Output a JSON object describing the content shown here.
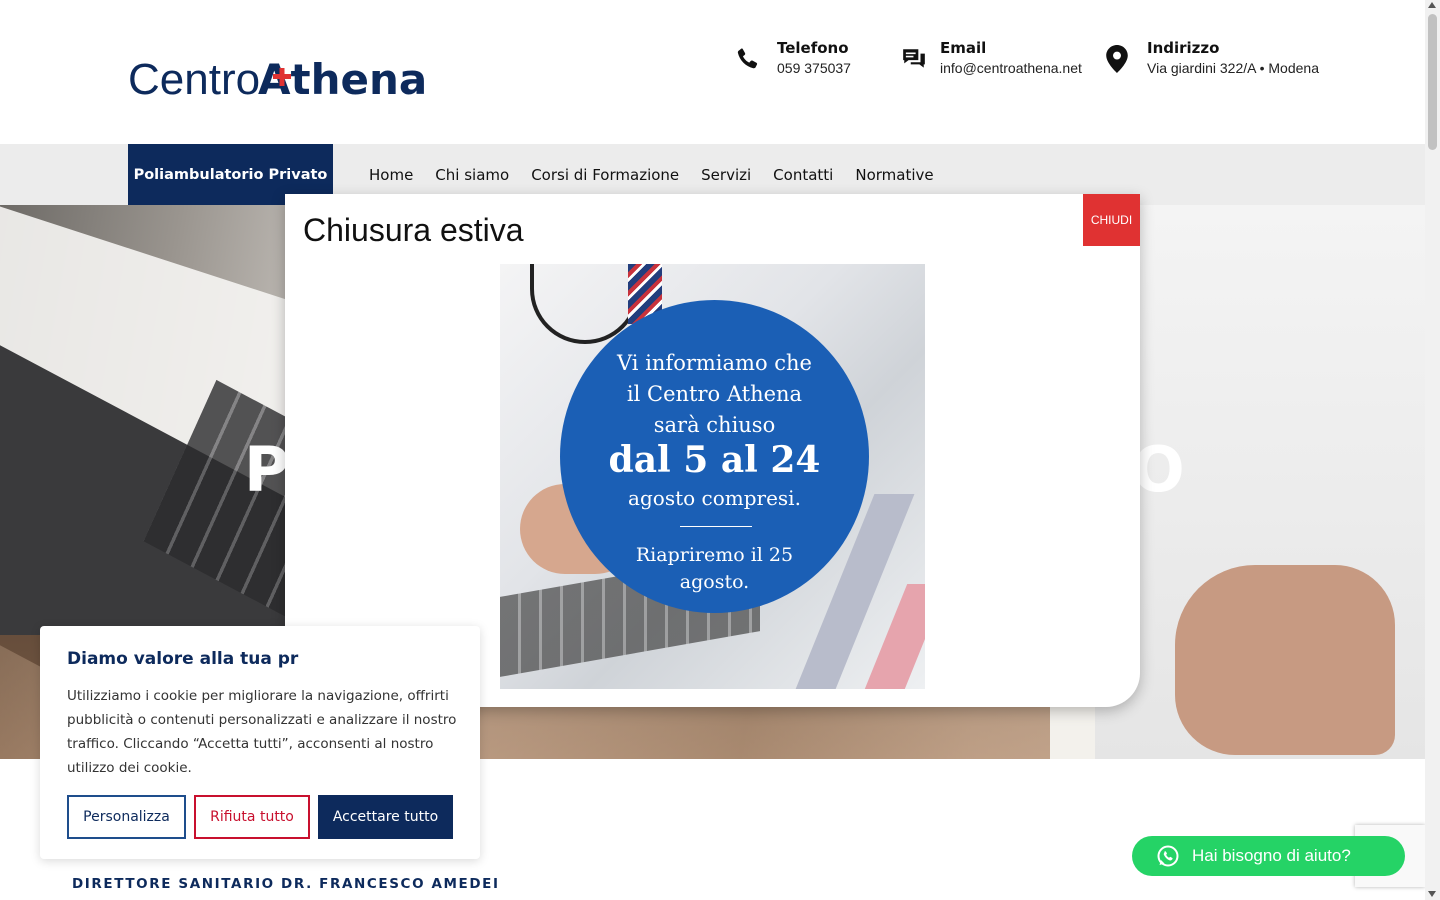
{
  "brand": {
    "logo_text_a": "Centro",
    "logo_text_b": "Athena",
    "primary_color": "#0d2a5c",
    "accent_color": "#e03232"
  },
  "contacts": [
    {
      "label": "Telefono",
      "value": "059 375037",
      "icon": "phone-icon"
    },
    {
      "label": "Email",
      "value": "info@centroathena.net",
      "icon": "chat-icon"
    },
    {
      "label": "Indirizzo",
      "value": "Via giardini 322/A • Modena",
      "icon": "map-pin-icon"
    }
  ],
  "nav": {
    "brand_label": "Poliambulatorio Privato",
    "items": [
      "Home",
      "Chi siamo",
      "Corsi di Formazione",
      "Servizi",
      "Contatti",
      "Normative"
    ]
  },
  "hero": {
    "title_start": "P",
    "title_end": "O"
  },
  "popup": {
    "title": "Chiusura estiva",
    "close_label": "CHIUDI",
    "flyer": {
      "line1": "Vi informiamo che",
      "line2": "il Centro Athena",
      "line3": "sarà chiuso",
      "dates": "dal 5 al 24",
      "line4": "agosto compresi.",
      "reopen1": "Riapriremo il 25",
      "reopen2": "agosto."
    }
  },
  "cookie": {
    "title": "Diamo valore alla tua pr",
    "text": "Utilizziamo i cookie per migliorare la navigazione, offrirti pubblicità o contenuti personalizzati e analizzare il nostro traffico. Cliccando “Accetta tutti”, acconsenti al nostro utilizzo dei cookie.",
    "customize": "Personalizza",
    "reject": "Rifiuta tutto",
    "accept": "Accettare tutto"
  },
  "director": "DIRETTORE SANITARIO DR. FRANCESCO AMEDEI",
  "whatsapp": {
    "label": "Hai bisogno di aiuto?",
    "icon": "whatsapp-icon"
  }
}
